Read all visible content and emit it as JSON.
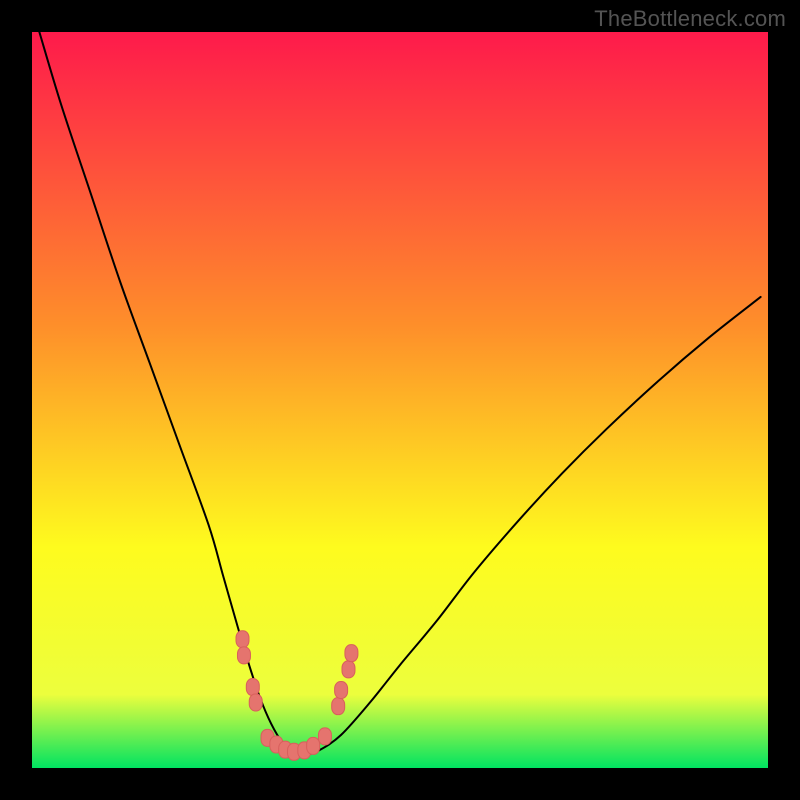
{
  "watermark": "TheBottleneck.com",
  "colors": {
    "gradient_top": "#fe1a4b",
    "gradient_mid1": "#fe8f2a",
    "gradient_mid2": "#fefb1e",
    "gradient_mid3": "#ecfe3d",
    "gradient_bottom": "#00e361",
    "curve": "#000000",
    "marker_fill": "#e5746e",
    "marker_stroke": "#d85f5c",
    "frame": "#000000"
  },
  "chart_data": {
    "type": "line",
    "title": "",
    "xlabel": "",
    "ylabel": "",
    "xlim": [
      0,
      100
    ],
    "ylim": [
      0,
      100
    ],
    "grid": false,
    "series": [
      {
        "name": "bottleneck-curve",
        "x": [
          1,
          4,
          8,
          12,
          16,
          20,
          24,
          26,
          28,
          29.5,
          31,
          32.5,
          34,
          35.5,
          37,
          39,
          42,
          46,
          50,
          55,
          60,
          66,
          72,
          78,
          85,
          92,
          99
        ],
        "y": [
          100,
          90,
          78,
          66,
          55,
          44,
          33,
          26,
          19,
          14,
          9.5,
          6,
          3.5,
          2.2,
          1.8,
          2.4,
          4.5,
          9,
          14,
          20,
          26.5,
          33.5,
          40,
          46,
          52.5,
          58.5,
          64
        ]
      }
    ],
    "markers": [
      {
        "x": 28.6,
        "y": 17.5
      },
      {
        "x": 28.8,
        "y": 15.3
      },
      {
        "x": 30.0,
        "y": 11.0
      },
      {
        "x": 30.4,
        "y": 8.9
      },
      {
        "x": 32.0,
        "y": 4.1
      },
      {
        "x": 33.2,
        "y": 3.2
      },
      {
        "x": 34.4,
        "y": 2.5
      },
      {
        "x": 35.6,
        "y": 2.2
      },
      {
        "x": 37.0,
        "y": 2.4
      },
      {
        "x": 38.2,
        "y": 3.0
      },
      {
        "x": 39.8,
        "y": 4.3
      },
      {
        "x": 41.6,
        "y": 8.4
      },
      {
        "x": 42.0,
        "y": 10.6
      },
      {
        "x": 43.0,
        "y": 13.4
      },
      {
        "x": 43.4,
        "y": 15.6
      }
    ],
    "minimum_x": 35.5
  }
}
